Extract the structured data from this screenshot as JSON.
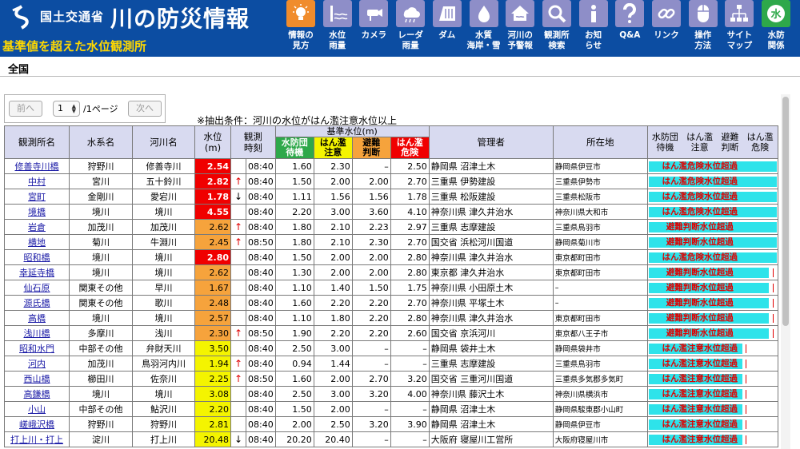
{
  "header": {
    "ministry": "国土交通省",
    "site_title": "川の防災情報",
    "page_title": "基準値を超えた水位観測所"
  },
  "nav": [
    {
      "label": "情報の\n見方",
      "icon": "lightbulb-icon",
      "color": "#f08c2c"
    },
    {
      "label": "水位\n雨量",
      "icon": "water-level-icon",
      "color": "#8e8ec8"
    },
    {
      "label": "カメラ",
      "icon": "camera-icon",
      "color": "#8e8ec8"
    },
    {
      "label": "レーダ\n雨量",
      "icon": "radar-rain-icon",
      "color": "#8e8ec8"
    },
    {
      "label": "ダム",
      "icon": "dam-icon",
      "color": "#8e8ec8"
    },
    {
      "label": "水質\n海岸・雪",
      "icon": "water-quality-icon",
      "color": "#8e8ec8"
    },
    {
      "label": "河川の\n予警報",
      "icon": "house-warning-icon",
      "color": "#8e8ec8"
    },
    {
      "label": "観測所\n検索",
      "icon": "search-icon",
      "color": "#8e8ec8"
    },
    {
      "label": "お知\nらせ",
      "icon": "info-icon",
      "color": "#8e8ec8"
    },
    {
      "label": "Q&A",
      "icon": "question-icon",
      "color": "#8e8ec8"
    },
    {
      "label": "リンク",
      "icon": "link-icon",
      "color": "#8e8ec8"
    },
    {
      "label": "操作\n方法",
      "icon": "mouse-icon",
      "color": "#8e8ec8"
    },
    {
      "label": "サイト\nマップ",
      "icon": "sitemap-icon",
      "color": "#8e8ec8"
    },
    {
      "label": "水防\n関係",
      "icon": "water-defense-icon",
      "color": "#2ea84a"
    }
  ],
  "region": "全国",
  "pager": {
    "prev": "前へ",
    "page": "1",
    "total": "/1ページ",
    "next": "次へ"
  },
  "condition": "※抽出条件：河川の水位がはん濫注意水位以上",
  "table": {
    "headers": {
      "station": "観測所名",
      "system": "水系名",
      "river": "河川名",
      "level": "水位\n(m)",
      "time": "観測\n時刻",
      "std_caption": "基準水位(m)",
      "std_standby": "水防団\n待機",
      "std_caution": "はん濫\n注意",
      "std_evac": "避難\n判断",
      "std_danger": "はん濫\n危険",
      "manager": "管理者",
      "location": "所在地",
      "status_h": [
        "水防団\n待機",
        "はん濫\n注意",
        "避難\n判断",
        "はん濫\n危険"
      ]
    },
    "std_colors": {
      "standby": "#2ea84a",
      "caution": "#f4f400",
      "evac": "#f6a33c",
      "danger": "#f00000"
    },
    "rows": [
      {
        "station": "修善寺川橋",
        "system": "狩野川",
        "river": "修善寺川",
        "level": "2.54",
        "lv": "red",
        "trend": "",
        "time": "08:40",
        "standby": "1.60",
        "caution": "2.30",
        "evac": "–",
        "danger": "2.50",
        "manager": "静岡県 沼津土木",
        "location": "静岡県伊豆市",
        "status": "はん濫危険水位超過",
        "fill": 1.0
      },
      {
        "station": "中村",
        "system": "宮川",
        "river": "五十鈴川",
        "level": "2.82",
        "lv": "red",
        "trend": "↑",
        "time": "08:40",
        "standby": "1.50",
        "caution": "2.00",
        "evac": "2.00",
        "danger": "2.70",
        "manager": "三重県 伊勢建設",
        "location": "三重県伊勢市",
        "status": "はん濫危険水位超過",
        "fill": 1.0
      },
      {
        "station": "宮町",
        "system": "金剛川",
        "river": "愛宕川",
        "level": "1.78",
        "lv": "red",
        "trend": "↓",
        "time": "08:40",
        "standby": "1.11",
        "caution": "1.56",
        "evac": "1.56",
        "danger": "1.78",
        "manager": "三重県 松阪建設",
        "location": "三重県松阪市",
        "status": "はん濫危険水位超過",
        "fill": 1.0
      },
      {
        "station": "境橋",
        "system": "境川",
        "river": "境川",
        "level": "4.55",
        "lv": "red",
        "trend": "",
        "time": "08:40",
        "standby": "2.20",
        "caution": "3.00",
        "evac": "3.60",
        "danger": "4.10",
        "manager": "神奈川県 津久井治水",
        "location": "神奈川県大和市",
        "status": "はん濫危険水位超過",
        "fill": 1.0
      },
      {
        "station": "岩倉",
        "system": "加茂川",
        "river": "加茂川",
        "level": "2.62",
        "lv": "orange",
        "trend": "↑",
        "time": "08:40",
        "standby": "1.80",
        "caution": "2.10",
        "evac": "2.23",
        "danger": "2.97",
        "manager": "三重県 志摩建設",
        "location": "三重県鳥羽市",
        "status": "避難判断水位超過",
        "fill": 1.0
      },
      {
        "station": "横地",
        "system": "菊川",
        "river": "牛淵川",
        "level": "2.45",
        "lv": "orange",
        "trend": "↑",
        "time": "08:50",
        "standby": "1.80",
        "caution": "2.10",
        "evac": "2.30",
        "danger": "2.70",
        "manager": "国交省 浜松河川国道",
        "location": "静岡県菊川市",
        "status": "避難判断水位超過",
        "fill": 1.0
      },
      {
        "station": "昭和橋",
        "system": "境川",
        "river": "境川",
        "level": "2.80",
        "lv": "red",
        "trend": "",
        "time": "08:40",
        "standby": "1.50",
        "caution": "2.00",
        "evac": "2.00",
        "danger": "2.80",
        "manager": "神奈川県 津久井治水",
        "location": "東京都町田市",
        "status": "はん濫危険水位超過",
        "fill": 1.0
      },
      {
        "station": "幸延寺橋",
        "system": "境川",
        "river": "境川",
        "level": "2.62",
        "lv": "orange",
        "trend": "",
        "time": "08:40",
        "standby": "1.30",
        "caution": "2.00",
        "evac": "2.00",
        "danger": "2.80",
        "manager": "東京都 津久井治水",
        "location": "東京都町田市",
        "status": "避難判断水位超過",
        "fill": 0.94
      },
      {
        "station": "仙石原",
        "system": "関東その他",
        "river": "早川",
        "level": "1.67",
        "lv": "orange",
        "trend": "",
        "time": "08:40",
        "standby": "1.10",
        "caution": "1.40",
        "evac": "1.50",
        "danger": "1.75",
        "manager": "神奈川県 小田原土木",
        "location": "–",
        "status": "避難判断水位超過",
        "fill": 0.94
      },
      {
        "station": "源氏橋",
        "system": "関東その他",
        "river": "歌川",
        "level": "2.48",
        "lv": "orange",
        "trend": "",
        "time": "08:40",
        "standby": "1.60",
        "caution": "2.20",
        "evac": "2.20",
        "danger": "2.70",
        "manager": "神奈川県 平塚土木",
        "location": "–",
        "status": "避難判断水位超過",
        "fill": 0.94
      },
      {
        "station": "高橋",
        "system": "境川",
        "river": "境川",
        "level": "2.57",
        "lv": "orange",
        "trend": "",
        "time": "08:40",
        "standby": "1.10",
        "caution": "1.80",
        "evac": "2.20",
        "danger": "2.80",
        "manager": "神奈川県 津久井治水",
        "location": "東京都町田市",
        "status": "避難判断水位超過",
        "fill": 0.94
      },
      {
        "station": "浅川橋",
        "system": "多摩川",
        "river": "浅川",
        "level": "2.30",
        "lv": "orange",
        "trend": "↑",
        "time": "08:50",
        "standby": "1.90",
        "caution": "2.20",
        "evac": "2.20",
        "danger": "2.60",
        "manager": "国交省 京浜河川",
        "location": "東京都八王子市",
        "status": "避難判断水位超過",
        "fill": 0.94
      },
      {
        "station": "昭和水門",
        "system": "中部その他",
        "river": "弁財天川",
        "level": "3.50",
        "lv": "yellow",
        "trend": "",
        "time": "08:40",
        "standby": "2.50",
        "caution": "3.00",
        "evac": "–",
        "danger": "–",
        "manager": "静岡県 袋井土木",
        "location": "静岡県袋井市",
        "status": "はん濫注意水位超過",
        "fill": 0.73
      },
      {
        "station": "河内",
        "system": "加茂川",
        "river": "鳥羽河内川",
        "level": "1.94",
        "lv": "yellow",
        "trend": "↑",
        "time": "08:40",
        "standby": "0.94",
        "caution": "1.44",
        "evac": "–",
        "danger": "–",
        "manager": "三重県 志摩建設",
        "location": "三重県鳥羽市",
        "status": "はん濫注意水位超過",
        "fill": 0.73
      },
      {
        "station": "西山橋",
        "system": "櫛田川",
        "river": "佐奈川",
        "level": "2.25",
        "lv": "yellow",
        "trend": "↑",
        "time": "08:50",
        "standby": "1.60",
        "caution": "2.00",
        "evac": "2.70",
        "danger": "3.20",
        "manager": "国交省 三重河川国道",
        "location": "三重県多気郡多気町",
        "status": "はん濫注意水位超過",
        "fill": 0.73
      },
      {
        "station": "高鎌橋",
        "system": "境川",
        "river": "境川",
        "level": "3.08",
        "lv": "yellow",
        "trend": "",
        "time": "08:40",
        "standby": "2.50",
        "caution": "3.00",
        "evac": "3.20",
        "danger": "4.00",
        "manager": "神奈川県 藤沢土木",
        "location": "神奈川県横浜市",
        "status": "はん濫注意水位超過",
        "fill": 0.73
      },
      {
        "station": "小山",
        "system": "中部その他",
        "river": "鮎沢川",
        "level": "2.20",
        "lv": "yellow",
        "trend": "",
        "time": "08:40",
        "standby": "1.50",
        "caution": "2.00",
        "evac": "–",
        "danger": "–",
        "manager": "静岡県 沼津土木",
        "location": "静岡県駿東郡小山町",
        "status": "はん濫注意水位超過",
        "fill": 0.73
      },
      {
        "station": "嵯峨沢橋",
        "system": "狩野川",
        "river": "狩野川",
        "level": "2.81",
        "lv": "yellow",
        "trend": "",
        "time": "08:40",
        "standby": "2.00",
        "caution": "2.50",
        "evac": "3.20",
        "danger": "3.90",
        "manager": "静岡県 沼津土木",
        "location": "静岡県伊豆市",
        "status": "はん濫注意水位超過",
        "fill": 0.73
      },
      {
        "station": "打上川・打上",
        "system": "淀川",
        "river": "打上川",
        "level": "20.48",
        "lv": "yellow",
        "trend": "↓",
        "time": "08:40",
        "standby": "20.20",
        "caution": "20.40",
        "evac": "–",
        "danger": "–",
        "manager": "大阪府 寝屋川工営所",
        "location": "大阪府寝屋川市",
        "status": "はん濫注意水位超過",
        "fill": 0.73
      }
    ]
  }
}
